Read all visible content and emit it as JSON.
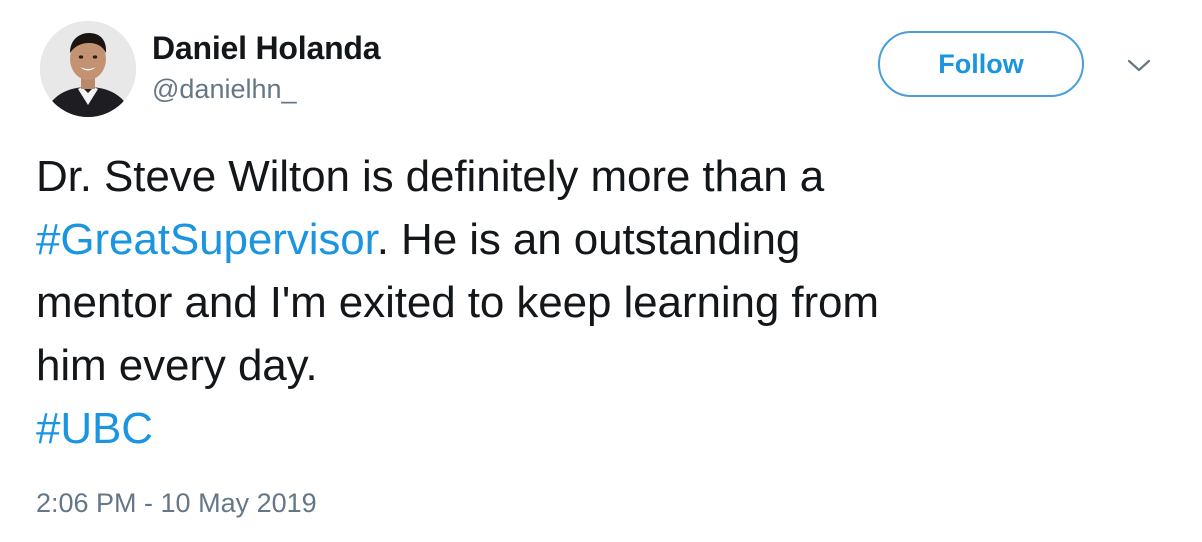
{
  "tweet": {
    "author": {
      "display_name": "Daniel Holanda",
      "handle": "@danielhn_",
      "avatar_icon": "profile-photo"
    },
    "follow_label": "Follow",
    "menu_icon": "chevron-down-icon",
    "text_lines": {
      "l1": "Dr. Steve Wilton is definitely more than a",
      "l2_hashtag": "#GreatSupervisor",
      "l2_rest": ". He is an outstanding",
      "l3": "mentor and I'm exited to keep learning from",
      "l4": "him every day.",
      "l5_hashtag": "#UBC"
    },
    "timestamp": "2:06 PM - 10 May 2019"
  },
  "colors": {
    "text": "#14171a",
    "secondary": "#657786",
    "link": "#1b95e0",
    "follow_border": "#4a9eda"
  }
}
